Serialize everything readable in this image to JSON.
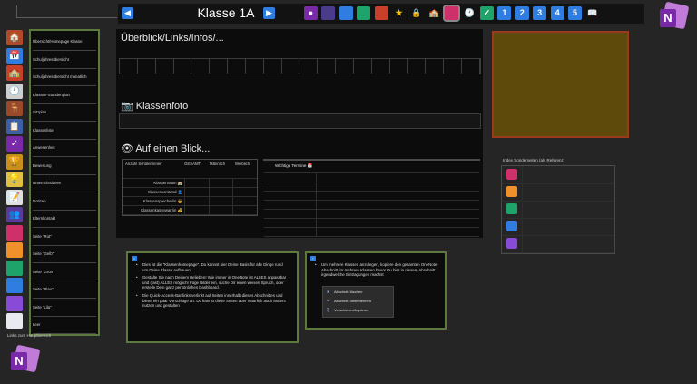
{
  "header": {
    "title": "Klasse 1A",
    "prev_icon": "triangle-left-icon",
    "next_icon": "triangle-right-icon",
    "nav_icons": [
      {
        "name": "person-icon",
        "color": "#7a2aa8",
        "glyph": "●"
      },
      {
        "name": "notebook-dark-icon",
        "color": "#4a3c8a",
        "glyph": ""
      },
      {
        "name": "notebook-blue-icon",
        "color": "#2f7de0",
        "glyph": ""
      },
      {
        "name": "notebook-green-icon",
        "color": "#1ea36a",
        "glyph": ""
      },
      {
        "name": "notebook-red-icon",
        "color": "#c8402a",
        "glyph": ""
      },
      {
        "name": "star-icon",
        "color": "#121212",
        "glyph": "★",
        "glyph_color": "#f2c21b"
      },
      {
        "name": "lock-icon",
        "color": "#121212",
        "glyph": "🔒"
      },
      {
        "name": "school-icon",
        "color": "#121212",
        "glyph": "🏫"
      },
      {
        "name": "bag-icon",
        "color": "#d0306a",
        "glyph": ""
      },
      {
        "name": "clock-icon",
        "color": "#121212",
        "glyph": "🕐"
      },
      {
        "name": "checkbox-icon",
        "color": "#1ea36a",
        "glyph": "✓"
      },
      {
        "name": "number-1-icon",
        "color": "#2f7de0",
        "glyph": "1"
      },
      {
        "name": "number-2-icon",
        "color": "#2f7de0",
        "glyph": "2"
      },
      {
        "name": "number-3-icon",
        "color": "#2f7de0",
        "glyph": "3"
      },
      {
        "name": "number-4-icon",
        "color": "#2f7de0",
        "glyph": "4"
      },
      {
        "name": "number-5-icon",
        "color": "#2f7de0",
        "glyph": "5"
      },
      {
        "name": "book-icon",
        "color": "#121212",
        "glyph": "📖"
      }
    ],
    "selected_icon": 8
  },
  "sidebar": {
    "items": [
      {
        "label": "Übersicht/Homepage Klasse",
        "icon": "house-icon",
        "color": "#b04a2a",
        "glyph": "🏠"
      },
      {
        "label": "Schuljahresübersicht",
        "icon": "calendar-icon",
        "color": "#2f7de0",
        "glyph": "📅"
      },
      {
        "label": "Schuljahresübersicht monatlich",
        "icon": "school-building-icon",
        "color": "#c8402a",
        "glyph": "🏫"
      },
      {
        "label": "Klassen-Stundenplan",
        "icon": "clock-icon",
        "color": "#cfcfcf",
        "glyph": "🕐"
      },
      {
        "label": "Sitzplan",
        "icon": "desk-person-icon",
        "color": "#9a4a2a",
        "glyph": "🪑"
      },
      {
        "label": "Klassenliste",
        "icon": "list-icon",
        "color": "#3d5fa8",
        "glyph": "📋"
      },
      {
        "label": "Anwesenheit",
        "icon": "checkbox-icon",
        "color": "#7a2aa8",
        "glyph": "✓"
      },
      {
        "label": "Bewertung",
        "icon": "trophy-icon",
        "color": "#c8901a",
        "glyph": "🏆"
      },
      {
        "label": "Unterrichtsideen",
        "icon": "lightbulb-icon",
        "color": "#e0c040",
        "glyph": "💡"
      },
      {
        "label": "Notizen",
        "icon": "notes-icon",
        "color": "#e0e0e0",
        "glyph": "📝"
      },
      {
        "label": "Elternkontakt",
        "icon": "people-icon",
        "color": "#5a3a9a",
        "glyph": "👥"
      },
      {
        "label": "Seite \"Rot\"",
        "icon": "notebook-red-icon",
        "color": "#d0306a",
        "glyph": ""
      },
      {
        "label": "Seite \"Gelb\"",
        "icon": "notebook-orange-icon",
        "color": "#f0902a",
        "glyph": ""
      },
      {
        "label": "Seite \"Grün\"",
        "icon": "notebook-green-icon",
        "color": "#1ea36a",
        "glyph": ""
      },
      {
        "label": "Seite \"Blau\"",
        "icon": "notebook-blue-icon",
        "color": "#2f7de0",
        "glyph": ""
      },
      {
        "label": "Seite \"Lila\"",
        "icon": "notebook-purple-icon",
        "color": "#8a4ad8",
        "glyph": ""
      },
      {
        "label": "Leer",
        "icon": "notebook-white-icon",
        "color": "#e8e8f0",
        "glyph": ""
      }
    ],
    "footer": "Links zum Hauptbereich"
  },
  "main": {
    "heading1": "Überblick/Links/Infos/...",
    "heading2": "📷 Klassenfoto",
    "heading3": "👁 Auf einen Blick...",
    "overview": {
      "corner": "Anzahl Schüler/innen",
      "columns": [
        "GESAMT",
        "Männlich",
        "Weiblich"
      ],
      "rows": [
        "Klassenraum 🏫",
        "Klassenvorstand 👤",
        "Klassensprecher/in 👦",
        "Klassenkassewart/in 💰"
      ]
    },
    "dates_header": "Wichtige Termine 📅"
  },
  "index": {
    "title": "Index Sonderseiten (als Referenz)",
    "colors": [
      "#d0306a",
      "#f0902a",
      "#1ea36a",
      "#2f7de0",
      "#8a4ad8"
    ]
  },
  "info1": {
    "bullets": [
      "Dies ist die \"Klassenhomepage\". Du kannst hier Deine Basis für alle Dinge rund um Deine Klasse aufbauen.",
      "Gestalte Sie nach Deinem Belieben! Wie immer in OneNote ist ALLES anpassbar und (fast) ALLES möglich! Füge Bilder ein, suche Dir einen weisen Spruch, oder erstelle Dein ganz persönliches Dashboard.",
      "Die Quick-Access-Bar links verlinkt auf Seiten innerhalb dieses Abschnittes und bietet ein paar Vorschläge an. Du kannst diese Seiten aber natürlich auch anders nutzen und gestalten"
    ]
  },
  "info2": {
    "bullets": [
      "Um mehrere Klassen anzulegen, kopiere den gesamten OneNote-Abschnitt für mehrere Klassen bevor Du hier in diesem Abschnitt irgendwelche Eintragungen machst"
    ],
    "menu": [
      "Abschnitt löschen",
      "Abschnitt umbenennen",
      "Verschieben/kopieren"
    ]
  }
}
